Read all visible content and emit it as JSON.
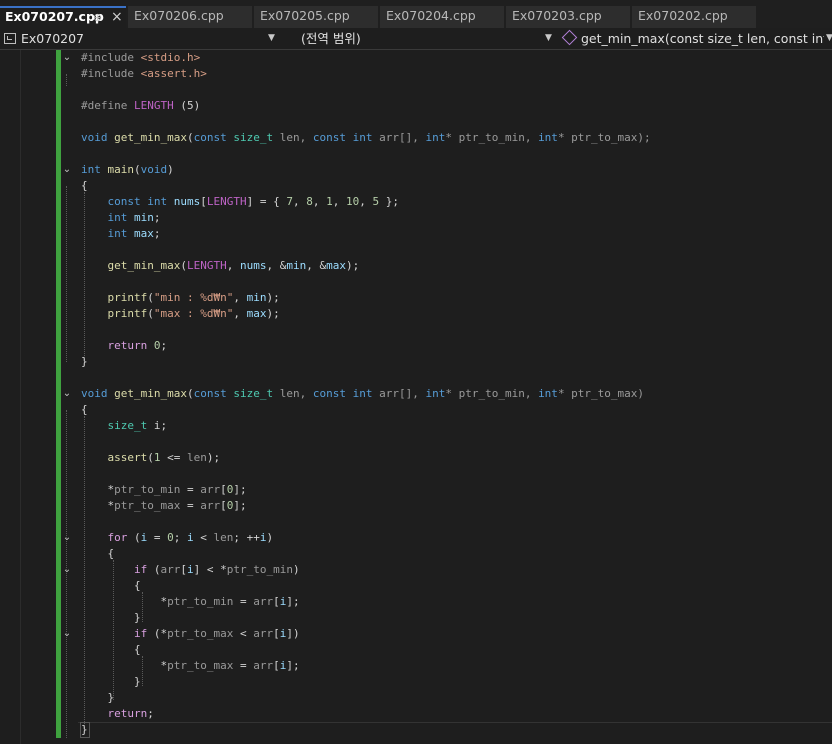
{
  "tabs": [
    {
      "label": "Ex070207.cpp",
      "active": true
    },
    {
      "label": "Ex070206.cpp",
      "active": false
    },
    {
      "label": "Ex070205.cpp",
      "active": false
    },
    {
      "label": "Ex070204.cpp",
      "active": false
    },
    {
      "label": "Ex070203.cpp",
      "active": false
    },
    {
      "label": "Ex070202.cpp",
      "active": false
    }
  ],
  "tab_icons": {
    "pin": "pin-icon",
    "close": "close-icon"
  },
  "navbar": {
    "project": "Ex070207",
    "scope": "(전역 범위)",
    "member": "get_min_max(const size_t len, const int arr[], "
  },
  "colors": {
    "keyword": "#569cd6",
    "type": "#4ec9b0",
    "function": "#dcdcaa",
    "string": "#d69d85",
    "number": "#b5cea8",
    "macro": "#bd63c5",
    "control": "#d8a0df",
    "change_bar": "#3fa23f",
    "active_tab_accent": "#3a72c8"
  },
  "code_lines": [
    [
      {
        "t": "#include ",
        "c": "pp"
      },
      {
        "t": "<stdio.h>",
        "c": "str"
      }
    ],
    [
      {
        "t": "#include ",
        "c": "pp"
      },
      {
        "t": "<assert.h>",
        "c": "str"
      }
    ],
    [],
    [
      {
        "t": "#define ",
        "c": "pp"
      },
      {
        "t": "LENGTH",
        "c": "mac"
      },
      {
        "t": " (5)",
        "c": ""
      }
    ],
    [],
    [
      {
        "t": "void ",
        "c": "kw"
      },
      {
        "t": "get_min_max",
        "c": "fn"
      },
      {
        "t": "(",
        "c": ""
      },
      {
        "t": "const ",
        "c": "kw"
      },
      {
        "t": "size_t",
        "c": "ty"
      },
      {
        "t": " len, ",
        "c": "par"
      },
      {
        "t": "const ",
        "c": "kw"
      },
      {
        "t": "int",
        "c": "kw"
      },
      {
        "t": " arr[], ",
        "c": "par"
      },
      {
        "t": "int",
        "c": "kw"
      },
      {
        "t": "* ptr_to_min, ",
        "c": "par"
      },
      {
        "t": "int",
        "c": "kw"
      },
      {
        "t": "* ptr_to_max);",
        "c": "par"
      }
    ],
    [],
    [
      {
        "t": "int ",
        "c": "kw"
      },
      {
        "t": "main",
        "c": "fn"
      },
      {
        "t": "(",
        "c": ""
      },
      {
        "t": "void",
        "c": "kw"
      },
      {
        "t": ")",
        "c": ""
      }
    ],
    [
      {
        "t": "{",
        "c": ""
      }
    ],
    [
      {
        "t": "    ",
        "c": ""
      },
      {
        "t": "const ",
        "c": "kw"
      },
      {
        "t": "int ",
        "c": "kw"
      },
      {
        "t": "nums",
        "c": "var"
      },
      {
        "t": "[",
        "c": ""
      },
      {
        "t": "LENGTH",
        "c": "mac"
      },
      {
        "t": "] = { ",
        "c": ""
      },
      {
        "t": "7",
        "c": "num"
      },
      {
        "t": ", ",
        "c": ""
      },
      {
        "t": "8",
        "c": "num"
      },
      {
        "t": ", ",
        "c": ""
      },
      {
        "t": "1",
        "c": "num"
      },
      {
        "t": ", ",
        "c": ""
      },
      {
        "t": "10",
        "c": "num"
      },
      {
        "t": ", ",
        "c": ""
      },
      {
        "t": "5",
        "c": "num"
      },
      {
        "t": " };",
        "c": ""
      }
    ],
    [
      {
        "t": "    ",
        "c": ""
      },
      {
        "t": "int ",
        "c": "kw"
      },
      {
        "t": "min",
        "c": "var"
      },
      {
        "t": ";",
        "c": ""
      }
    ],
    [
      {
        "t": "    ",
        "c": ""
      },
      {
        "t": "int ",
        "c": "kw"
      },
      {
        "t": "max",
        "c": "var"
      },
      {
        "t": ";",
        "c": ""
      }
    ],
    [],
    [
      {
        "t": "    ",
        "c": ""
      },
      {
        "t": "get_min_max",
        "c": "fn"
      },
      {
        "t": "(",
        "c": ""
      },
      {
        "t": "LENGTH",
        "c": "mac"
      },
      {
        "t": ", ",
        "c": ""
      },
      {
        "t": "nums",
        "c": "var"
      },
      {
        "t": ", &",
        "c": ""
      },
      {
        "t": "min",
        "c": "var"
      },
      {
        "t": ", &",
        "c": ""
      },
      {
        "t": "max",
        "c": "var"
      },
      {
        "t": ");",
        "c": ""
      }
    ],
    [],
    [
      {
        "t": "    ",
        "c": ""
      },
      {
        "t": "printf",
        "c": "fn"
      },
      {
        "t": "(",
        "c": ""
      },
      {
        "t": "\"min : %d₩n\"",
        "c": "str"
      },
      {
        "t": ", ",
        "c": ""
      },
      {
        "t": "min",
        "c": "var"
      },
      {
        "t": ");",
        "c": ""
      }
    ],
    [
      {
        "t": "    ",
        "c": ""
      },
      {
        "t": "printf",
        "c": "fn"
      },
      {
        "t": "(",
        "c": ""
      },
      {
        "t": "\"max : %d₩n\"",
        "c": "str"
      },
      {
        "t": ", ",
        "c": ""
      },
      {
        "t": "max",
        "c": "var"
      },
      {
        "t": ");",
        "c": ""
      }
    ],
    [],
    [
      {
        "t": "    ",
        "c": ""
      },
      {
        "t": "return ",
        "c": "ctl"
      },
      {
        "t": "0",
        "c": "num"
      },
      {
        "t": ";",
        "c": ""
      }
    ],
    [
      {
        "t": "}",
        "c": ""
      }
    ],
    [],
    [
      {
        "t": "void ",
        "c": "kw"
      },
      {
        "t": "get_min_max",
        "c": "fn"
      },
      {
        "t": "(",
        "c": ""
      },
      {
        "t": "const ",
        "c": "kw"
      },
      {
        "t": "size_t",
        "c": "ty"
      },
      {
        "t": " len, ",
        "c": "par"
      },
      {
        "t": "const ",
        "c": "kw"
      },
      {
        "t": "int",
        "c": "kw"
      },
      {
        "t": " arr[], ",
        "c": "par"
      },
      {
        "t": "int",
        "c": "kw"
      },
      {
        "t": "* ptr_to_min, ",
        "c": "par"
      },
      {
        "t": "int",
        "c": "kw"
      },
      {
        "t": "* ptr_to_max)",
        "c": "par"
      }
    ],
    [
      {
        "t": "{",
        "c": ""
      }
    ],
    [
      {
        "t": "    ",
        "c": ""
      },
      {
        "t": "size_t",
        "c": "ty"
      },
      {
        "t": " i;",
        "c": ""
      }
    ],
    [],
    [
      {
        "t": "    ",
        "c": ""
      },
      {
        "t": "assert",
        "c": "fn"
      },
      {
        "t": "(",
        "c": ""
      },
      {
        "t": "1",
        "c": "num"
      },
      {
        "t": " <= ",
        "c": ""
      },
      {
        "t": "len",
        "c": "par"
      },
      {
        "t": ");",
        "c": ""
      }
    ],
    [],
    [
      {
        "t": "    *",
        "c": ""
      },
      {
        "t": "ptr_to_min",
        "c": "par"
      },
      {
        "t": " = ",
        "c": ""
      },
      {
        "t": "arr",
        "c": "par"
      },
      {
        "t": "[",
        "c": ""
      },
      {
        "t": "0",
        "c": "num"
      },
      {
        "t": "];",
        "c": ""
      }
    ],
    [
      {
        "t": "    *",
        "c": ""
      },
      {
        "t": "ptr_to_max",
        "c": "par"
      },
      {
        "t": " = ",
        "c": ""
      },
      {
        "t": "arr",
        "c": "par"
      },
      {
        "t": "[",
        "c": ""
      },
      {
        "t": "0",
        "c": "num"
      },
      {
        "t": "];",
        "c": ""
      }
    ],
    [],
    [
      {
        "t": "    ",
        "c": ""
      },
      {
        "t": "for",
        "c": "ctl"
      },
      {
        "t": " (",
        "c": ""
      },
      {
        "t": "i",
        "c": "var"
      },
      {
        "t": " = ",
        "c": ""
      },
      {
        "t": "0",
        "c": "num"
      },
      {
        "t": "; ",
        "c": ""
      },
      {
        "t": "i",
        "c": "var"
      },
      {
        "t": " < ",
        "c": ""
      },
      {
        "t": "len",
        "c": "par"
      },
      {
        "t": "; ++",
        "c": ""
      },
      {
        "t": "i",
        "c": "var"
      },
      {
        "t": ")",
        "c": ""
      }
    ],
    [
      {
        "t": "    {",
        "c": ""
      }
    ],
    [
      {
        "t": "        ",
        "c": ""
      },
      {
        "t": "if",
        "c": "ctl"
      },
      {
        "t": " (",
        "c": ""
      },
      {
        "t": "arr",
        "c": "par"
      },
      {
        "t": "[",
        "c": ""
      },
      {
        "t": "i",
        "c": "var"
      },
      {
        "t": "] < *",
        "c": ""
      },
      {
        "t": "ptr_to_min",
        "c": "par"
      },
      {
        "t": ")",
        "c": ""
      }
    ],
    [
      {
        "t": "        {",
        "c": ""
      }
    ],
    [
      {
        "t": "            *",
        "c": ""
      },
      {
        "t": "ptr_to_min",
        "c": "par"
      },
      {
        "t": " = ",
        "c": ""
      },
      {
        "t": "arr",
        "c": "par"
      },
      {
        "t": "[",
        "c": ""
      },
      {
        "t": "i",
        "c": "var"
      },
      {
        "t": "];",
        "c": ""
      }
    ],
    [
      {
        "t": "        }",
        "c": ""
      }
    ],
    [
      {
        "t": "        ",
        "c": ""
      },
      {
        "t": "if",
        "c": "ctl"
      },
      {
        "t": " (*",
        "c": ""
      },
      {
        "t": "ptr_to_max",
        "c": "par"
      },
      {
        "t": " < ",
        "c": ""
      },
      {
        "t": "arr",
        "c": "par"
      },
      {
        "t": "[",
        "c": ""
      },
      {
        "t": "i",
        "c": "var"
      },
      {
        "t": "])",
        "c": ""
      }
    ],
    [
      {
        "t": "        {",
        "c": ""
      }
    ],
    [
      {
        "t": "            *",
        "c": ""
      },
      {
        "t": "ptr_to_max",
        "c": "par"
      },
      {
        "t": " = ",
        "c": ""
      },
      {
        "t": "arr",
        "c": "par"
      },
      {
        "t": "[",
        "c": ""
      },
      {
        "t": "i",
        "c": "var"
      },
      {
        "t": "];",
        "c": ""
      }
    ],
    [
      {
        "t": "        }",
        "c": ""
      }
    ],
    [
      {
        "t": "    }",
        "c": ""
      }
    ],
    [
      {
        "t": "    ",
        "c": ""
      },
      {
        "t": "return",
        "c": "ctl"
      },
      {
        "t": ";",
        "c": ""
      }
    ],
    [
      {
        "t": "}",
        "c": ""
      }
    ]
  ],
  "fold_markers": [
    0,
    7,
    21,
    30,
    32,
    36
  ]
}
